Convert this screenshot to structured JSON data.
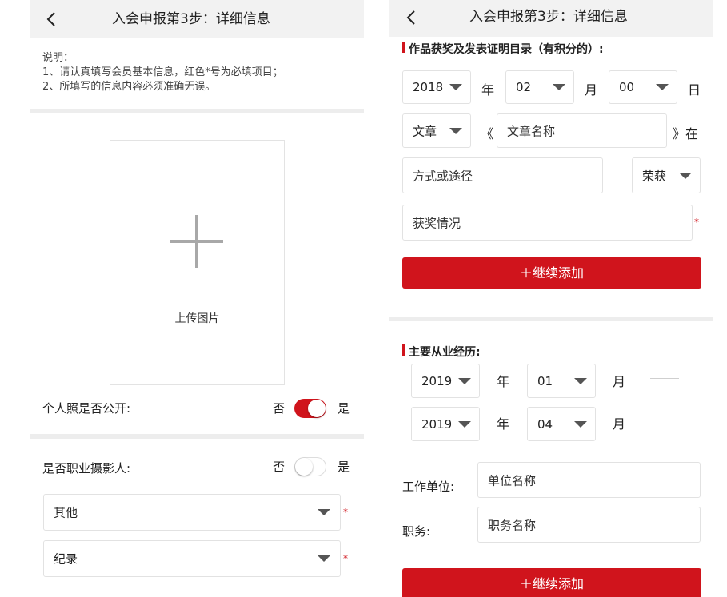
{
  "left": {
    "header_title": "入会申报第3步：详细信息",
    "note_lines": [
      "说明：",
      "1、请认真填写会员基本信息，红色*号为必填项目；",
      "2、所填写的信息内容必须准确无误。"
    ],
    "upload_label": "上传图片",
    "photo_public": {
      "label": "个人照是否公开:",
      "no": "否",
      "yes": "是",
      "value": "on"
    },
    "pro_photographer": {
      "label": "是否职业摄影人:",
      "no": "否",
      "yes": "是",
      "value": "off"
    },
    "select_category": "其他",
    "select_genre": "纪录",
    "required_mark": "*"
  },
  "right": {
    "header_title": "入会申报第3步：详细信息",
    "awards": {
      "section_title": "作品获奖及发表证明目录（有积分的）:",
      "year": "2018",
      "year_unit": "年",
      "month": "02",
      "month_unit": "月",
      "day": "00",
      "day_unit": "日",
      "type": "文章",
      "open_quote": "《",
      "work_placeholder": "文章名称",
      "close_quote": "》在",
      "method_placeholder": "方式或途径",
      "honor": "荣获",
      "award_placeholder": "获奖情况",
      "required_mark": "*",
      "add_button": "＋继续添加"
    },
    "career": {
      "section_title": "主要从业经历:",
      "start_year": "2019",
      "start_year_unit": "年",
      "start_month": "01",
      "start_month_unit": "月",
      "end_year": "2019",
      "end_year_unit": "年",
      "end_month": "04",
      "end_month_unit": "月",
      "employer_label": "工作单位:",
      "employer_placeholder": "单位名称",
      "position_label": "职务:",
      "position_placeholder": "职务名称",
      "add_button": "＋继续添加"
    }
  },
  "colors": {
    "accent": "#d0141c",
    "header_bg": "#f2f2f2",
    "divider": "#ededed"
  }
}
